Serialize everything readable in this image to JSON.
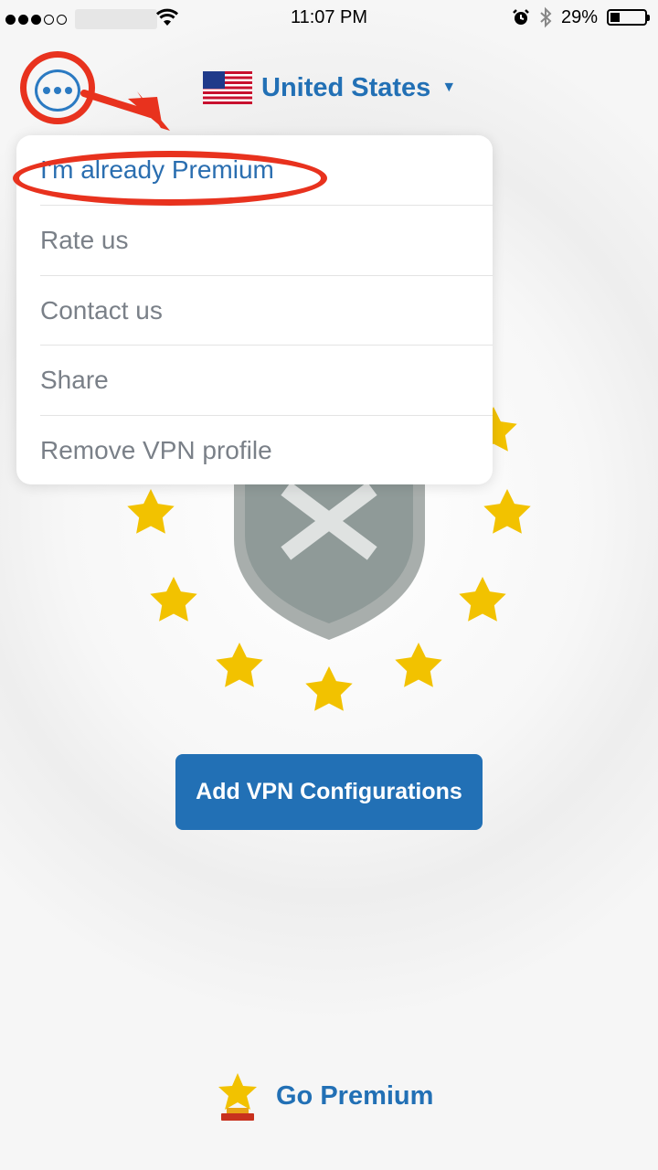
{
  "status_bar": {
    "time": "11:07 PM",
    "battery_percent": "29%",
    "battery_level": 0.29
  },
  "header": {
    "country_name": "United States",
    "menu_button_icon": "more-dots-icon",
    "flag_icon": "us-flag-icon"
  },
  "menu": {
    "items": [
      {
        "label": "I'm already Premium",
        "highlighted": true
      },
      {
        "label": "Rate us"
      },
      {
        "label": "Contact us"
      },
      {
        "label": "Share"
      },
      {
        "label": "Remove VPN profile"
      }
    ]
  },
  "main": {
    "status_icon": "shield-x-icon",
    "add_vpn_label": "Add VPN Configurations",
    "go_premium_label": "Go Premium",
    "go_premium_icon": "trophy-star-icon"
  },
  "annotations": {
    "highlight_color": "#e8321e"
  },
  "colors": {
    "accent": "#2270b5",
    "star": "#f2c200",
    "shield": "#8f9a98"
  }
}
